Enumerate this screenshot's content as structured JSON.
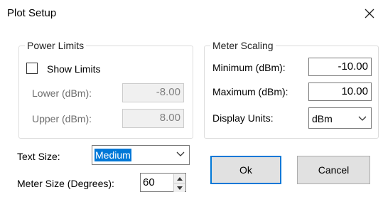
{
  "window": {
    "title": "Plot Setup",
    "close_icon": "close-icon"
  },
  "power_limits": {
    "group_label": "Power Limits",
    "show_limits_label": "Show Limits",
    "show_limits_checked": false,
    "lower_label": "Lower (dBm):",
    "lower_value": "-8.00",
    "upper_label": "Upper (dBm):",
    "upper_value": "8.00"
  },
  "meter_scaling": {
    "group_label": "Meter Scaling",
    "minimum_label": "Minimum (dBm):",
    "minimum_value": "-10.00",
    "maximum_label": "Maximum (dBm):",
    "maximum_value": "10.00",
    "display_units_label": "Display Units:",
    "display_units_value": "dBm"
  },
  "text_size": {
    "label": "Text Size:",
    "value": "Medium"
  },
  "meter_size": {
    "label": "Meter Size (Degrees):",
    "value": "60"
  },
  "buttons": {
    "ok_label": "Ok",
    "cancel_label": "Cancel"
  },
  "colors": {
    "accent": "#0078d7",
    "disabled_text": "#6d6d6d"
  }
}
